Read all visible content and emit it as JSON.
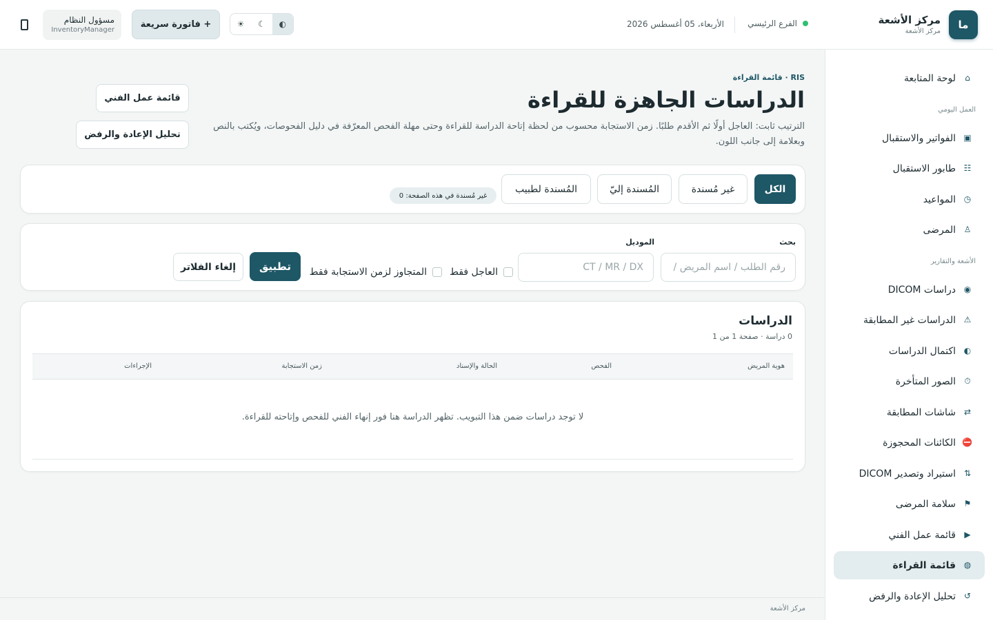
{
  "header": {
    "brand_initials": "ما",
    "brand_title": "مركز الأشعة",
    "brand_subtitle": "مركز الأشعة",
    "branch_label": "الفرع الرئيسي",
    "date_text": "الأربعاء، 05 أغسطس 2026",
    "quick_invoice_label": "+ فاتورة سريعة",
    "user_name": "مسؤول النظام",
    "user_role": "InventoryManager",
    "theme_options": [
      "☀",
      "☾",
      "◐"
    ],
    "colors": {
      "accent": "#1e5766",
      "status_online": "#2fbf71"
    }
  },
  "sidebar": {
    "dashboard": {
      "label": "لوحة المتابعة",
      "icon": "home-icon"
    },
    "section_daily": "العمل اليومي",
    "daily_items": [
      {
        "label": "الفواتير والاستقبال",
        "icon": "invoice-icon"
      },
      {
        "label": "طابور الاستقبال",
        "icon": "queue-icon"
      },
      {
        "label": "المواعيد",
        "icon": "clock-icon"
      },
      {
        "label": "المرضى",
        "icon": "person-icon"
      }
    ],
    "section_radiology": "الأشعة والتقارير",
    "radiology_items": [
      {
        "label": "دراسات DICOM",
        "icon": "target-icon"
      },
      {
        "label": "الدراسات غير المطابقة",
        "icon": "warning-icon"
      },
      {
        "label": "اكتمال الدراسات",
        "icon": "half-circle-icon"
      },
      {
        "label": "الصور المتأخرة",
        "icon": "timer-icon"
      },
      {
        "label": "شاشات المطابقة",
        "icon": "swap-icon"
      },
      {
        "label": "الكائنات المحجوزة",
        "icon": "blocked-icon"
      },
      {
        "label": "استيراد وتصدير DICOM",
        "icon": "import-export-icon"
      },
      {
        "label": "سلامة المرضى",
        "icon": "flag-icon"
      },
      {
        "label": "قائمة عمل الفني",
        "icon": "play-icon"
      },
      {
        "label": "قائمة القراءة",
        "icon": "reading-icon",
        "active": true
      },
      {
        "label": "تحليل الإعادة والرفض",
        "icon": "redo-icon"
      }
    ]
  },
  "main": {
    "breadcrumb": "RIS · قائمة القراءة",
    "title": "الدراسات الجاهزة للقراءة",
    "description": "الترتيب ثابت: العاجل أولًا ثم الأقدم طلبًا. زمن الاستجابة محسوب من لحظة إتاحة الدراسة للقراءة وحتى مهلة الفحص المعرّفة في دليل الفحوصات، ويُكتب بالنص وبعلامة إلى جانب اللون.",
    "tech_worklist_button": "قائمة عمل الفني",
    "reject_analysis_button": "تحليل الإعادة والرفض",
    "tabs": [
      {
        "label": "الكل",
        "active": true
      },
      {
        "label": "غير مُسندة"
      },
      {
        "label": "المُسندة إليّ"
      },
      {
        "label": "المُسندة لطبيب"
      }
    ],
    "unassigned_badge": "غير مُسندة في هذه الصفحة: 0"
  },
  "filters": {
    "search_label": "بحث",
    "search_placeholder": "رقم الطلب / اسم المريض / ...",
    "modality_label": "الموديل",
    "modality_placeholder": "CT / MR / DX",
    "urgent_only_label": "العاجل فقط",
    "overdue_only_label": "المتجاوز لزمن الاستجابة فقط",
    "apply_label": "تطبيق",
    "clear_label": "إلغاء الفلاتر"
  },
  "studies": {
    "title": "الدراسات",
    "meta": "0 دراسة · صفحة 1 من 1",
    "columns": [
      "هوية المريض",
      "الفحص",
      "الحالة والإسناد",
      "زمن الاستجابة",
      "الإجراءات"
    ],
    "rows": [],
    "empty_message": "لا توجد دراسات ضمن هذا التبويب. تظهر الدراسة هنا فور إنهاء الفني للفحص وإتاحته للقراءة."
  },
  "footer": {
    "text": "مركز الأشعة"
  }
}
